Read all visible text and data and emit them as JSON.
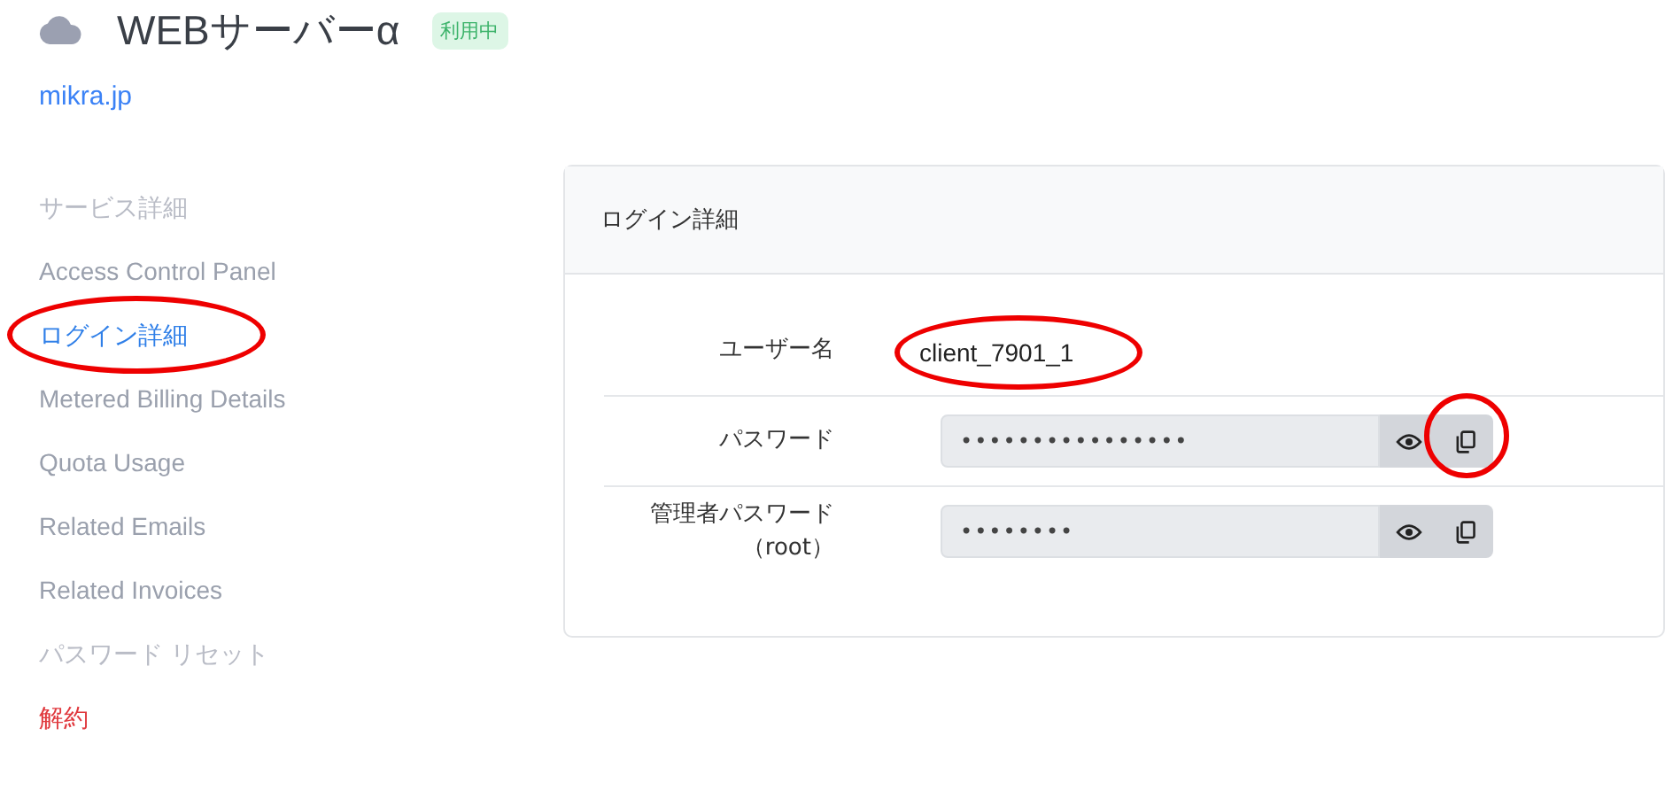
{
  "header": {
    "title": "WEBサーバーα",
    "status_badge": "利用中",
    "domain_link": "mikra.jp"
  },
  "sidebar": {
    "items": [
      {
        "label": "サービス詳細",
        "kind": "muted",
        "selected": false,
        "circled": false
      },
      {
        "label": "Access Control Panel",
        "kind": "link",
        "selected": false,
        "circled": false
      },
      {
        "label": "ログイン詳細",
        "kind": "link",
        "selected": true,
        "circled": true
      },
      {
        "label": "Metered Billing Details",
        "kind": "link",
        "selected": false,
        "circled": false
      },
      {
        "label": "Quota Usage",
        "kind": "link",
        "selected": false,
        "circled": false
      },
      {
        "label": "Related Emails",
        "kind": "link",
        "selected": false,
        "circled": false
      },
      {
        "label": "Related Invoices",
        "kind": "link",
        "selected": false,
        "circled": false
      },
      {
        "label": "パスワード リセット",
        "kind": "muted",
        "selected": false,
        "circled": false
      },
      {
        "label": "解約",
        "kind": "danger",
        "selected": false,
        "circled": false
      }
    ]
  },
  "card": {
    "title": "ログイン詳細",
    "rows": [
      {
        "label": "ユーザー名",
        "kind": "text",
        "value": "client_7901_1",
        "circled": true
      },
      {
        "label": "パスワード",
        "kind": "password",
        "value": "••••••••••••••••",
        "copy_circled": true
      },
      {
        "label": "管理者パスワード（root）",
        "kind": "password",
        "value": "••••••••",
        "copy_circled": false
      }
    ]
  }
}
